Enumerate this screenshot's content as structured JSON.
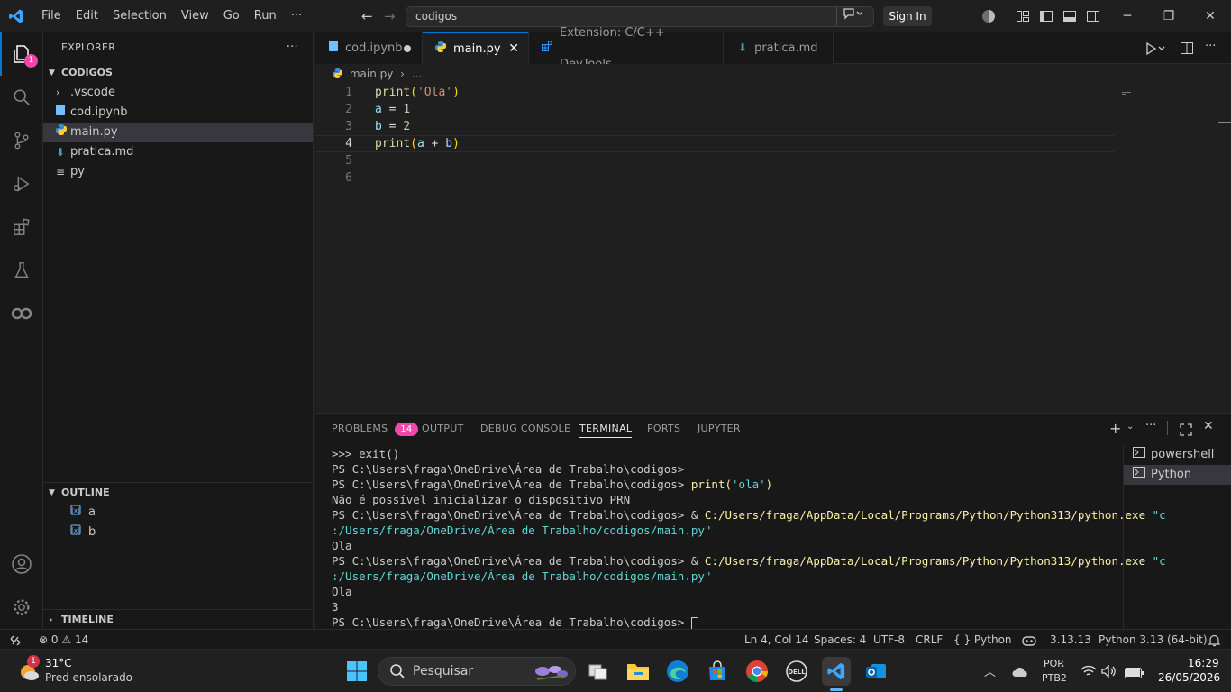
{
  "titlebar": {
    "menu": [
      "File",
      "Edit",
      "Selection",
      "View",
      "Go",
      "Run",
      "···"
    ],
    "command_center": "codigos",
    "sign_in": "Sign In"
  },
  "activity": {
    "explorer_badge": "1"
  },
  "sidebar": {
    "title": "EXPLORER",
    "more": "···",
    "folder": "CODIGOS",
    "files": [
      {
        "name": ".vscode",
        "icon": "chevron-right-icon"
      },
      {
        "name": "cod.ipynb",
        "icon": "notebook-file-icon"
      },
      {
        "name": "main.py",
        "icon": "python-file-icon"
      },
      {
        "name": "pratica.md",
        "icon": "markdown-file-icon"
      },
      {
        "name": "py",
        "icon": "text-file-icon"
      }
    ],
    "outline_title": "OUTLINE",
    "outline": [
      "a",
      "b"
    ],
    "timeline_title": "TIMELINE"
  },
  "tabs": [
    {
      "label": "cod.ipynb",
      "modified": true
    },
    {
      "label": "main.py",
      "active": true
    },
    {
      "label": "Extension: C/C++ DevTools"
    },
    {
      "label": "pratica.md"
    }
  ],
  "breadcrumb": {
    "file": "main.py",
    "rest": "..."
  },
  "editor": {
    "line_numbers": [
      "1",
      "2",
      "3",
      "4",
      "5",
      "6"
    ],
    "current_line": "4"
  },
  "panel": {
    "tabs": [
      "PROBLEMS",
      "OUTPUT",
      "DEBUG CONSOLE",
      "TERMINAL",
      "PORTS",
      "JUPYTER"
    ],
    "problems_count": "14",
    "terminals": [
      "powershell",
      "Python"
    ],
    "lines": [
      ">>> exit()",
      "PS C:\\Users\\fraga\\OneDrive\\Área de Trabalho\\codigos>",
      "PS C:\\Users\\fraga\\OneDrive\\Área de Trabalho\\codigos> print('ola')",
      "Não é possível inicializar o dispositivo PRN",
      "PS C:\\Users\\fraga\\OneDrive\\Área de Trabalho\\codigos> & C:/Users/fraga/AppData/Local/Programs/Python/Python313/python.exe \"c",
      ":/Users/fraga/OneDrive/Área de Trabalho/codigos/main.py\"",
      "Ola",
      "PS C:\\Users\\fraga\\OneDrive\\Área de Trabalho\\codigos> & C:/Users/fraga/AppData/Local/Programs/Python/Python313/python.exe \"c",
      ":/Users/fraga/OneDrive/Área de Trabalho/codigos/main.py\"",
      "Ola",
      "3",
      "PS C:\\Users\\fraga\\OneDrive\\Área de Trabalho\\codigos> "
    ],
    "prompt": "PS C:\\Users\\fraga\\OneDrive\\Área de Trabalho\\codigos> ",
    "cmd1": "print(",
    "cmd1_str": "'ola'",
    "cmd1_end": ")",
    "amp": "& ",
    "exe_path": "C:/Users/fraga/AppData/Local/Programs/Python/Python313/python.exe",
    "arg_start": " \"c",
    "arg_end": ":/Users/fraga/OneDrive/Área de Trabalho/codigos/main.py\""
  },
  "status": {
    "errors": "0",
    "warnings": "14",
    "position": "Ln 4, Col 14",
    "spaces": "Spaces: 4",
    "encoding": "UTF-8",
    "eol": "CRLF",
    "language": "Python",
    "braces": "{ }",
    "version": "3.13.13",
    "interpreter": "Python 3.13 (64-bit)"
  },
  "taskbar": {
    "weather_temp": "31°C",
    "weather_desc": "Pred ensolarado",
    "weather_badge": "1",
    "search": "Pesquisar",
    "lang1": "POR",
    "lang2": "PTB2",
    "time": "16:29",
    "date": "26/05/2026"
  },
  "colors": {
    "accent": "#0078d4",
    "badge": "#f048a8",
    "keyword": "#dcdcaa",
    "string": "#ce9178",
    "number": "#b5cea8",
    "variable": "#9cdcfe"
  }
}
